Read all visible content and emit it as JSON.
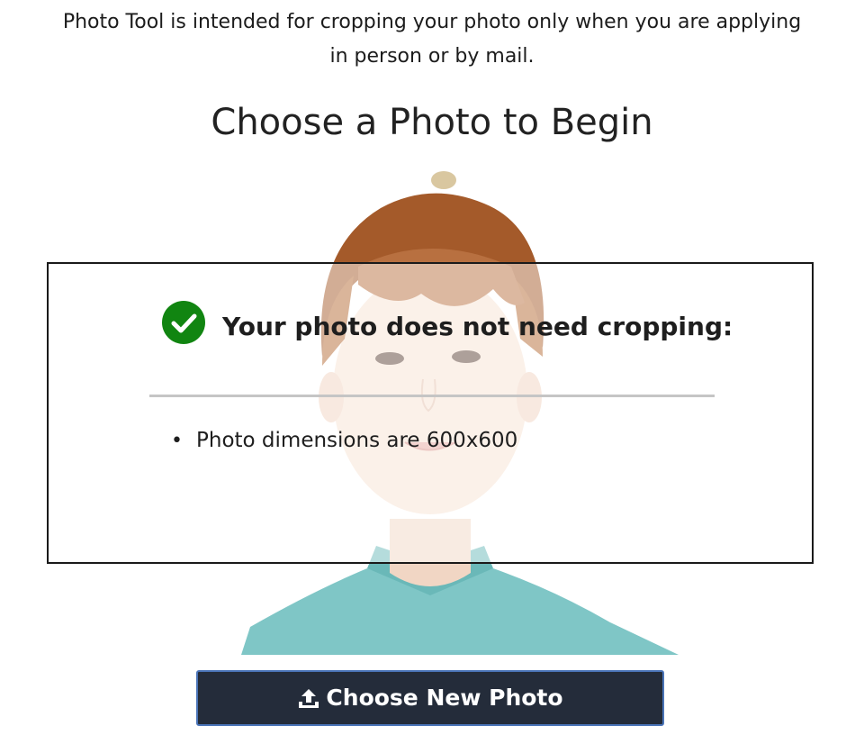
{
  "notice": {
    "line1": "Photo Tool is intended for cropping your photo only when you are applying",
    "line2": "in person or by mail."
  },
  "heading": "Choose a Photo to Begin",
  "result": {
    "status_icon": "check-circle-icon",
    "status_color": "#118511",
    "title": "Your photo does not need cropping:",
    "details": [
      "Photo dimensions are 600x600"
    ]
  },
  "button": {
    "icon": "upload-icon",
    "label": "Choose New Photo",
    "background": "#242c3a",
    "border_color": "#4a74b8"
  },
  "photo": {
    "description_icon": "portrait-photo"
  }
}
